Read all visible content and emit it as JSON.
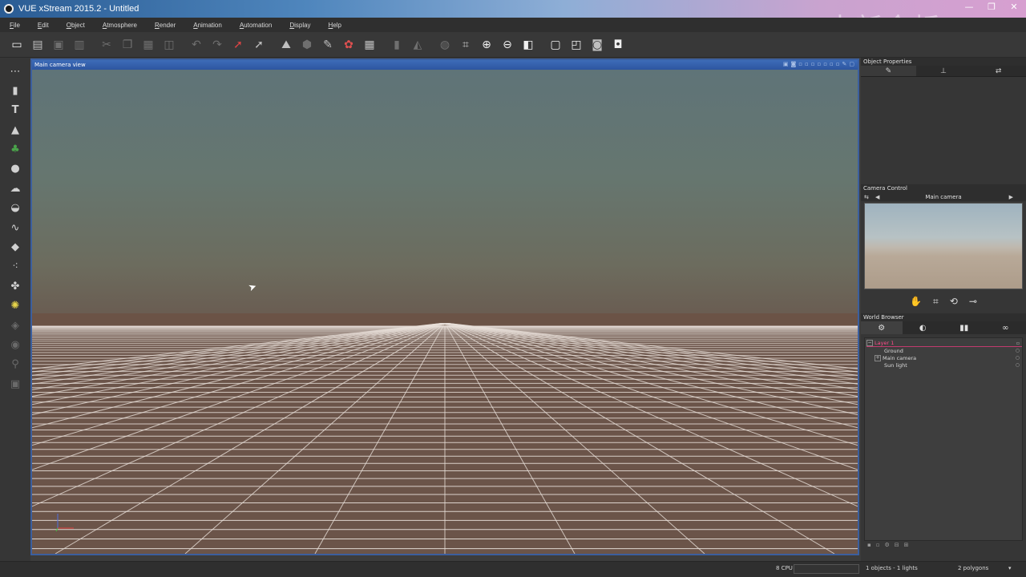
{
  "window": {
    "title": "VUE xStream 2015.2 - Untitled",
    "watermark": "中新金桥"
  },
  "titlebar": {
    "minimize": "—",
    "maximize": "❐",
    "close": "✕"
  },
  "menu": [
    "File",
    "Edit",
    "Object",
    "Atmosphere",
    "Render",
    "Animation",
    "Automation",
    "Display",
    "Help"
  ],
  "toolbar": {
    "icons": [
      "new-icon",
      "open-icon",
      "save-icon",
      "save-as-icon",
      "cut-icon",
      "copy-icon",
      "paste-icon",
      "duplicate-icon",
      "undo-icon",
      "redo-icon",
      "select-icon",
      "select-drag-icon",
      "terrain-icon",
      "cube-icon",
      "edit-object-icon",
      "material-icon",
      "film-icon",
      "align-icon",
      "symmetry-icon",
      "globe-icon",
      "frame-icon",
      "zoom-in-icon",
      "zoom-out-icon",
      "toggle-view-icon",
      "render-area-icon",
      "render-icon",
      "render-preview-icon",
      "camera-snapshot-icon"
    ]
  },
  "lefttools": [
    "marquee-icon",
    "cylinder-icon",
    "text-icon",
    "terrain-tool-icon",
    "tree-icon",
    "sphere-icon",
    "cloud-icon",
    "planet-icon",
    "spline-icon",
    "rock-icon",
    "plant-pack-icon",
    "fan-icon",
    "light-icon",
    "boolean-icon",
    "metablob-icon",
    "link-icon",
    "group-icon"
  ],
  "viewport": {
    "title": "Main camera view"
  },
  "objectProperties": {
    "title": "Object Properties",
    "tabs": [
      "aspect-tab-icon",
      "numerics-tab-icon",
      "animation-tab-icon"
    ]
  },
  "cameraControl": {
    "title": "Camera Control",
    "camera": "Main camera"
  },
  "worldBrowser": {
    "title": "World Browser",
    "tabs": [
      "objects-tab-icon",
      "materials-tab-icon",
      "library-tab-icon",
      "links-tab-icon"
    ],
    "tree": [
      {
        "label": "Layer 1",
        "type": "layer",
        "indent": 0,
        "expander": "−"
      },
      {
        "label": "Ground",
        "type": "item",
        "indent": 1,
        "expander": ""
      },
      {
        "label": "Main camera",
        "type": "item",
        "indent": 1,
        "expander": "+"
      },
      {
        "label": "Sun light",
        "type": "item",
        "indent": 1,
        "expander": ""
      }
    ]
  },
  "status": {
    "cpu": "8 CPU",
    "objects": "1 objects - 1 lights",
    "polygons": "2 polygons"
  }
}
